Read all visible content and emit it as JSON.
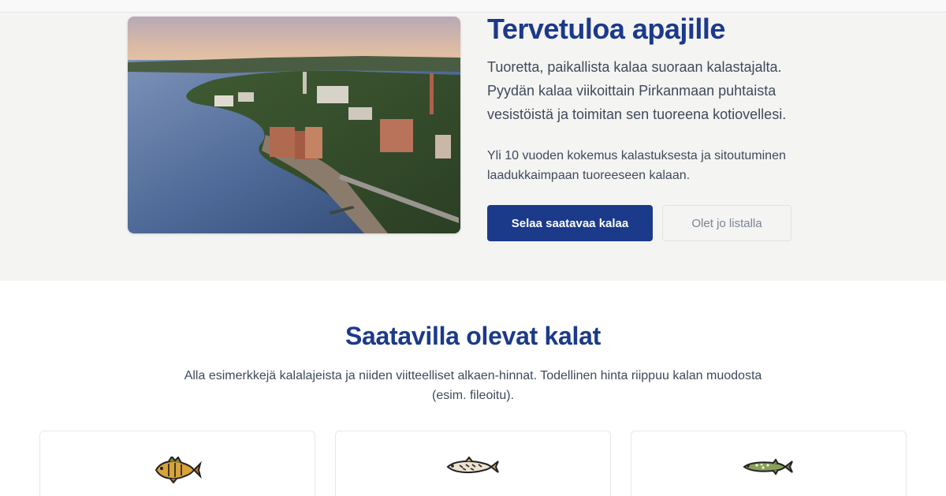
{
  "hero": {
    "title": "Tervetuloa apajille",
    "lead": "Tuoretta, paikallista kalaa suoraan kalastajalta. Pyydän kalaa viikoittain Pirkanmaan puhtaista vesistöistä ja toimitan sen tuoreena kotiovellesi.",
    "sub": "Yli 10 vuoden kokemus kalastuksesta ja sitoutuminen laadukkaimpaan tuoreeseen kalaan.",
    "primary_button": "Selaa saatavaa kalaa",
    "secondary_button": "Olet jo listalla"
  },
  "fish_section": {
    "title": "Saatavilla olevat kalat",
    "description": "Alla esimerkkejä kalalajeista ja niiden viitteelliset alkaen-hinnat. Todellinen hinta riippuu kalan muodosta (esim. fileoitu).",
    "cards": [
      {
        "icon": "perch-icon"
      },
      {
        "icon": "whitefish-icon"
      },
      {
        "icon": "pike-icon"
      }
    ]
  },
  "colors": {
    "brand": "#1c3a8a",
    "hero_background": "#f4f4f3",
    "text": "#3f4a5a"
  }
}
